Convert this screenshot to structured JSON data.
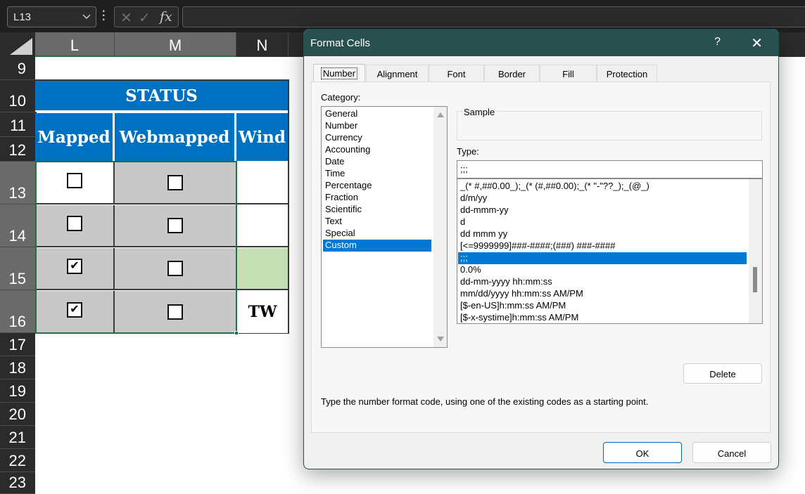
{
  "formula_bar": {
    "name_box": "L13",
    "cancel_icon": "✕",
    "enter_icon": "✓",
    "fx_label": "fx",
    "formula_value": ""
  },
  "sheet": {
    "columns": [
      "L",
      "M",
      "N"
    ],
    "rows": [
      "9",
      "10",
      "11",
      "12",
      "13",
      "14",
      "15",
      "16",
      "17",
      "18",
      "19",
      "20",
      "21",
      "22",
      "23"
    ],
    "table": {
      "title": "STATUS",
      "headers": [
        "Mapped",
        "Webmapped",
        "Wind"
      ],
      "data_rows": [
        {
          "row": "13",
          "mapped": false,
          "webmapped": false,
          "wind": ""
        },
        {
          "row": "14",
          "mapped": false,
          "webmapped": false,
          "wind": ""
        },
        {
          "row": "15",
          "mapped": true,
          "webmapped": false,
          "wind": ""
        },
        {
          "row": "16",
          "mapped": true,
          "webmapped": false,
          "wind": "TW"
        }
      ]
    },
    "colors": {
      "header_fill": "#0070c0",
      "selected_fill": "#c8c8c8",
      "wind_green_fill": "#c6dfb4",
      "selection_border": "#1e7145"
    }
  },
  "dialog": {
    "title": "Format Cells",
    "help_label": "?",
    "close_label": "✕",
    "tabs": [
      {
        "label": "Number",
        "active": true
      },
      {
        "label": "Alignment",
        "active": false
      },
      {
        "label": "Font",
        "active": false
      },
      {
        "label": "Border",
        "active": false
      },
      {
        "label": "Fill",
        "active": false
      },
      {
        "label": "Protection",
        "active": false
      }
    ],
    "category_label": "Category:",
    "categories": [
      "General",
      "Number",
      "Currency",
      "Accounting",
      "Date",
      "Time",
      "Percentage",
      "Fraction",
      "Scientific",
      "Text",
      "Special",
      "Custom"
    ],
    "selected_category": "Custom",
    "sample_label": "Sample",
    "sample_value": "",
    "type_label": "Type:",
    "type_value": ";;;",
    "type_list": [
      "_(* #,##0.00_);_(* (#,##0.00);_(* \"-\"??_);_(@_)",
      "d/m/yy",
      "dd-mmm-yy",
      "d",
      "dd mmm yy",
      "[<=9999999]###-####;(###) ###-####",
      ";;;",
      "0.0%",
      "dd-mm-yyyy hh:mm:ss",
      "mm/dd/yyyy hh:mm:ss AM/PM",
      "[$-en-US]h:mm:ss AM/PM",
      "[$-x-systime]h:mm:ss AM/PM"
    ],
    "selected_type": ";;;",
    "delete_label": "Delete",
    "hint": "Type the number format code, using one of the existing codes as a starting point.",
    "ok_label": "OK",
    "cancel_label": "Cancel",
    "accent_color": "#0078d4",
    "title_bar_color": "#27504f"
  }
}
